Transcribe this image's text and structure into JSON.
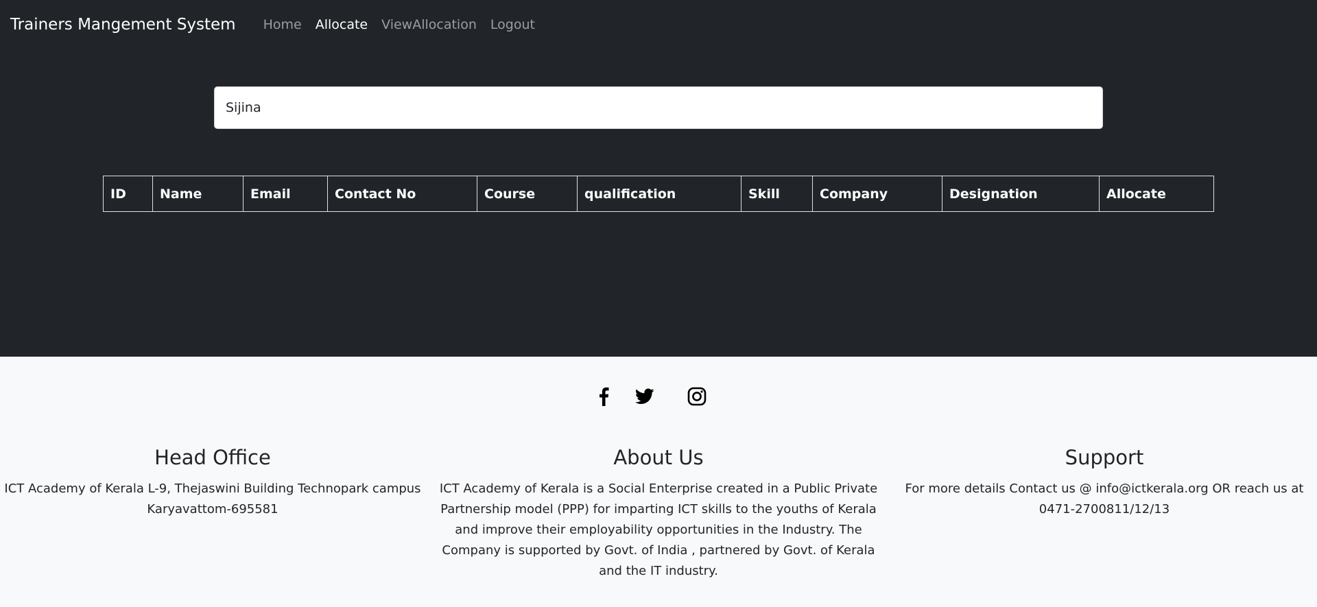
{
  "navbar": {
    "brand": "Trainers Mangement System",
    "links": [
      "Home",
      "Allocate",
      "ViewAllocation",
      "Logout"
    ],
    "active": "Allocate"
  },
  "search": {
    "value": "Sijina"
  },
  "table": {
    "headers": [
      "ID",
      "Name",
      "Email",
      "Contact No",
      "Course",
      "qualification",
      "Skill",
      "Company",
      "Designation",
      "Allocate"
    ]
  },
  "footer": {
    "social_icons": [
      "facebook-icon",
      "twitter-icon",
      "instagram-icon"
    ],
    "head_office": {
      "title": "Head Office",
      "text": "ICT Academy of Kerala L-9, Thejaswini Building Technopark campus Karyavattom-695581"
    },
    "about": {
      "title": "About Us",
      "text": "ICT Academy of Kerala is a Social Enterprise created in a Public Private Partnership model (PPP) for imparting ICT skills to the youths of Kerala and improve their employability opportunities in the Industry. The Company is supported by Govt. of India , partnered by Govt. of Kerala and the IT industry."
    },
    "support": {
      "title": "Support",
      "text": "For more details Contact us @ info@ictkerala.org OR reach us at 0471-2700811/12/13"
    }
  },
  "colors": {
    "dark_bg": "#212529",
    "light_bg": "#f8f9fa",
    "nav_muted": "rgba(255,255,255,0.55)"
  }
}
